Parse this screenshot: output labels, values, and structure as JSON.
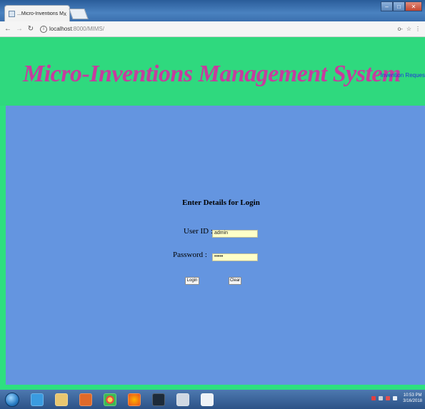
{
  "browser": {
    "tab_title": "...Micro-Inventions Man...",
    "tab_close": "x",
    "url_host": "localhost",
    "url_rest": ":8000/MIMS/",
    "info_icon": "i",
    "key_icon": "o-",
    "star_icon": "☆",
    "menu_icon": "⋮"
  },
  "header": {
    "title": "Micro-Inventions Management System",
    "top_link": "Invention Reques"
  },
  "login": {
    "heading": "Enter Details for Login",
    "user_label": "User ID :",
    "user_value": "admin",
    "password_label": "Password :",
    "password_value": "•••••",
    "login_button": "Login",
    "clear_button": "Clear"
  },
  "taskbar": {
    "clock_time": "10:53 PM",
    "clock_date": "3/16/2018"
  },
  "colors": {
    "banner": "#2fd97e",
    "content": "#6495e0",
    "title": "#c63c9e",
    "field": "#ffffc8"
  }
}
